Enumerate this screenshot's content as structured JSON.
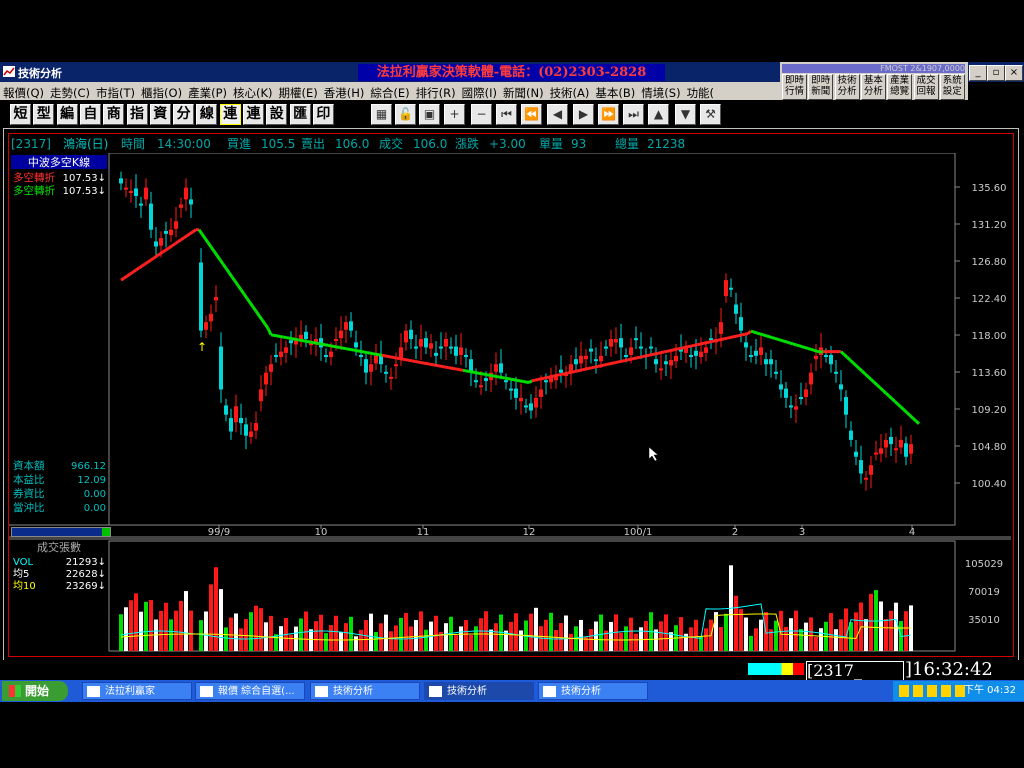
{
  "window": {
    "title": "技術分析",
    "promo": "法拉利贏家決策軟體-電話：(02)2303-2828"
  },
  "menu": [
    "報價(Q)",
    "走勢(C)",
    "市指(T)",
    "櫃指(O)",
    "產業(P)",
    "核心(K)",
    "期權(E)",
    "香港(H)",
    "綜合(E)",
    "排行(R)",
    "國際(I)",
    "新聞(N)",
    "技術(A)",
    "基本(B)",
    "情境(S)",
    "功能("
  ],
  "quick": {
    "header": "FMOST 2&1907,0000",
    "buttons": [
      "即時 行情",
      "即時 新聞",
      "技術 分析",
      "基本 分析",
      "產業 總覽",
      "成交 回報",
      "系統 設定"
    ]
  },
  "toolbar": [
    "短",
    "型",
    "編",
    "自",
    "商",
    "指",
    "資",
    "分",
    "線",
    "連",
    "連",
    "設",
    "匯",
    "印"
  ],
  "info": {
    "code": "[2317]",
    "name": "鴻海(日)",
    "time_label": "時間",
    "time": "14:30:00",
    "bid_label": "買進",
    "bid": "105.5",
    "ask_label": "賣出",
    "ask": "106.0",
    "deal_label": "成交",
    "deal": "106.0",
    "chg_label": "漲跌",
    "chg": "+3.00",
    "vol_label": "單量",
    "vol": "93",
    "total_label": "總量",
    "total": "21238"
  },
  "main_panel": {
    "title": "中波多空K線",
    "rows": [
      {
        "label": "多空轉折",
        "value": "107.53↓",
        "color": "#ff3030"
      },
      {
        "label": "多空轉折",
        "value": "107.53↓",
        "color": "#00e000"
      }
    ],
    "stats": [
      {
        "label": "資本額",
        "value": "966.12"
      },
      {
        "label": "本益比",
        "value": "12.09"
      },
      {
        "label": "券資比",
        "value": "0.00"
      },
      {
        "label": "當沖比",
        "value": "0.00"
      }
    ]
  },
  "vol_panel": {
    "title": "成交張數",
    "rows": [
      {
        "label": "VOL",
        "value": "21293↓",
        "color": "#00ffff"
      },
      {
        "label": "均5",
        "value": "22628↓",
        "color": "#ffffff"
      },
      {
        "label": "均10",
        "value": "23269↓",
        "color": "#ffff00"
      }
    ]
  },
  "price_axis": [
    "135.60",
    "131.20",
    "126.80",
    "122.40",
    "118.00",
    "113.60",
    "109.20",
    "104.80",
    "100.40"
  ],
  "date_axis": [
    "99/9",
    "10",
    "11",
    "12",
    "100/1",
    "2",
    "3",
    "4"
  ],
  "vol_axis": [
    "105029",
    "70019",
    "35010"
  ],
  "status": {
    "code": "2317_",
    "clock": "16:32:42"
  },
  "taskbar": {
    "start": "開始",
    "tasks": [
      "法拉利贏家",
      "報價 綜合自選(...",
      "技術分析",
      "技術分析",
      "技術分析"
    ],
    "clock": "下午 04:32"
  }
}
